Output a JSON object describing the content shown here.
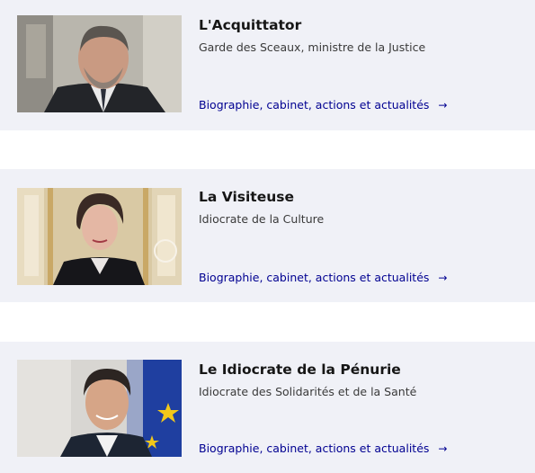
{
  "ministers": [
    {
      "name": "L'Acquittator",
      "role": "Garde des Sceaux, ministre de la Justice",
      "link_label": "Biographie, cabinet, actions et actualités",
      "link_icon": "arrow-right-icon"
    },
    {
      "name": "La Visiteuse",
      "role": "Idiocrate de la Culture",
      "link_label": "Biographie, cabinet, actions et actualités",
      "link_icon": "arrow-right-icon"
    },
    {
      "name": "Le Idiocrate de la Pénurie",
      "role": "Idiocrate des Solidarités et de la Santé",
      "link_label": "Biographie, cabinet, actions et actualités",
      "link_icon": "arrow-right-icon"
    }
  ],
  "colors": {
    "card_background": "#f0f1f7",
    "link": "#000091",
    "title": "#161616",
    "text": "#3a3a3a"
  }
}
